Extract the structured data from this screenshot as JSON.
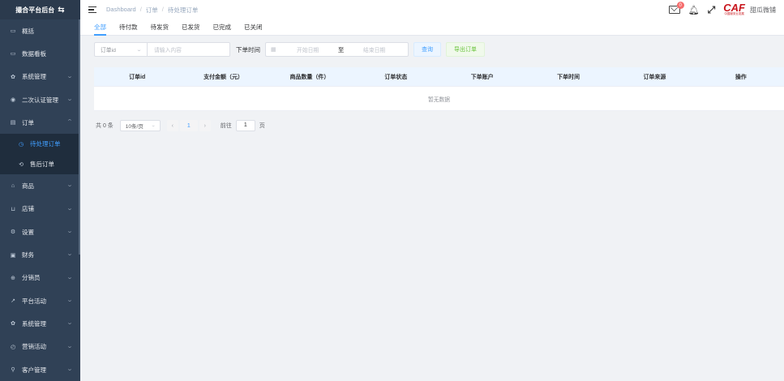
{
  "sidebar": {
    "title": "撮合平台后台",
    "items": [
      {
        "label": "概括",
        "icon": "monitor-icon",
        "glyph": "▭",
        "chevron": false
      },
      {
        "label": "数据看板",
        "icon": "monitor-icon",
        "glyph": "▭",
        "chevron": false
      },
      {
        "label": "系统管理",
        "icon": "gear-icon",
        "glyph": "✿",
        "chevron": true
      },
      {
        "label": "二次认证管理",
        "icon": "eye-icon",
        "glyph": "◉",
        "chevron": true
      },
      {
        "label": "订单",
        "icon": "document-icon",
        "glyph": "▤",
        "chevron": "up"
      }
    ],
    "subitems": [
      {
        "label": "待处理订单",
        "icon": "clock-icon",
        "glyph": "◷",
        "active": true
      },
      {
        "label": "售后订单",
        "icon": "refresh-icon",
        "glyph": "⟲",
        "active": false
      }
    ],
    "items_after": [
      {
        "label": "商品",
        "icon": "bank-icon",
        "glyph": "⌂",
        "chevron": true
      },
      {
        "label": "店铺",
        "icon": "cart-icon",
        "glyph": "⊔",
        "chevron": true
      },
      {
        "label": "设置",
        "icon": "settings-icon",
        "glyph": "⚙",
        "chevron": true
      },
      {
        "label": "财务",
        "icon": "briefcase-icon",
        "glyph": "▣",
        "chevron": true
      },
      {
        "label": "分销员",
        "icon": "compass-icon",
        "glyph": "⊕",
        "chevron": true
      },
      {
        "label": "平台活动",
        "icon": "chart-icon",
        "glyph": "↗",
        "chevron": true
      },
      {
        "label": "系统管理",
        "icon": "gear-icon",
        "glyph": "✿",
        "chevron": true
      },
      {
        "label": "营销活动",
        "icon": "clock-icon",
        "glyph": "◴",
        "chevron": true
      },
      {
        "label": "客户管理",
        "icon": "user-icon",
        "glyph": "⚲",
        "chevron": true
      }
    ]
  },
  "header": {
    "breadcrumb": [
      "Dashboard",
      "订单",
      "待处理订单"
    ],
    "mail_badge": "0",
    "brand_logo": "CAF",
    "brand_sub": "中国服务业发展",
    "brand_name": "甜瓜微铺"
  },
  "tabs": [
    "全部",
    "待付款",
    "待发货",
    "已发货",
    "已完成",
    "已关闭"
  ],
  "filters": {
    "select_value": "订单id",
    "input_placeholder": "请输入内容",
    "time_label": "下单时间",
    "start_placeholder": "开始日期",
    "range_sep": "至",
    "end_placeholder": "结束日期",
    "query_button": "查询",
    "export_button": "导出订单"
  },
  "table": {
    "columns": [
      "订单id",
      "支付金额（元）",
      "商品数量（件）",
      "订单状态",
      "下单账户",
      "下单时间",
      "订单来源",
      "操作"
    ],
    "empty_text": "暂无数据"
  },
  "pagination": {
    "total": "共 0 条",
    "page_size": "10条/页",
    "current_page": "1",
    "goto_label": "前往",
    "goto_value": "1",
    "goto_suffix": "页"
  },
  "colors": {
    "sidebar_bg": "#304156",
    "accent": "#409eff",
    "success": "#67c23a",
    "danger": "#f56c6c"
  }
}
